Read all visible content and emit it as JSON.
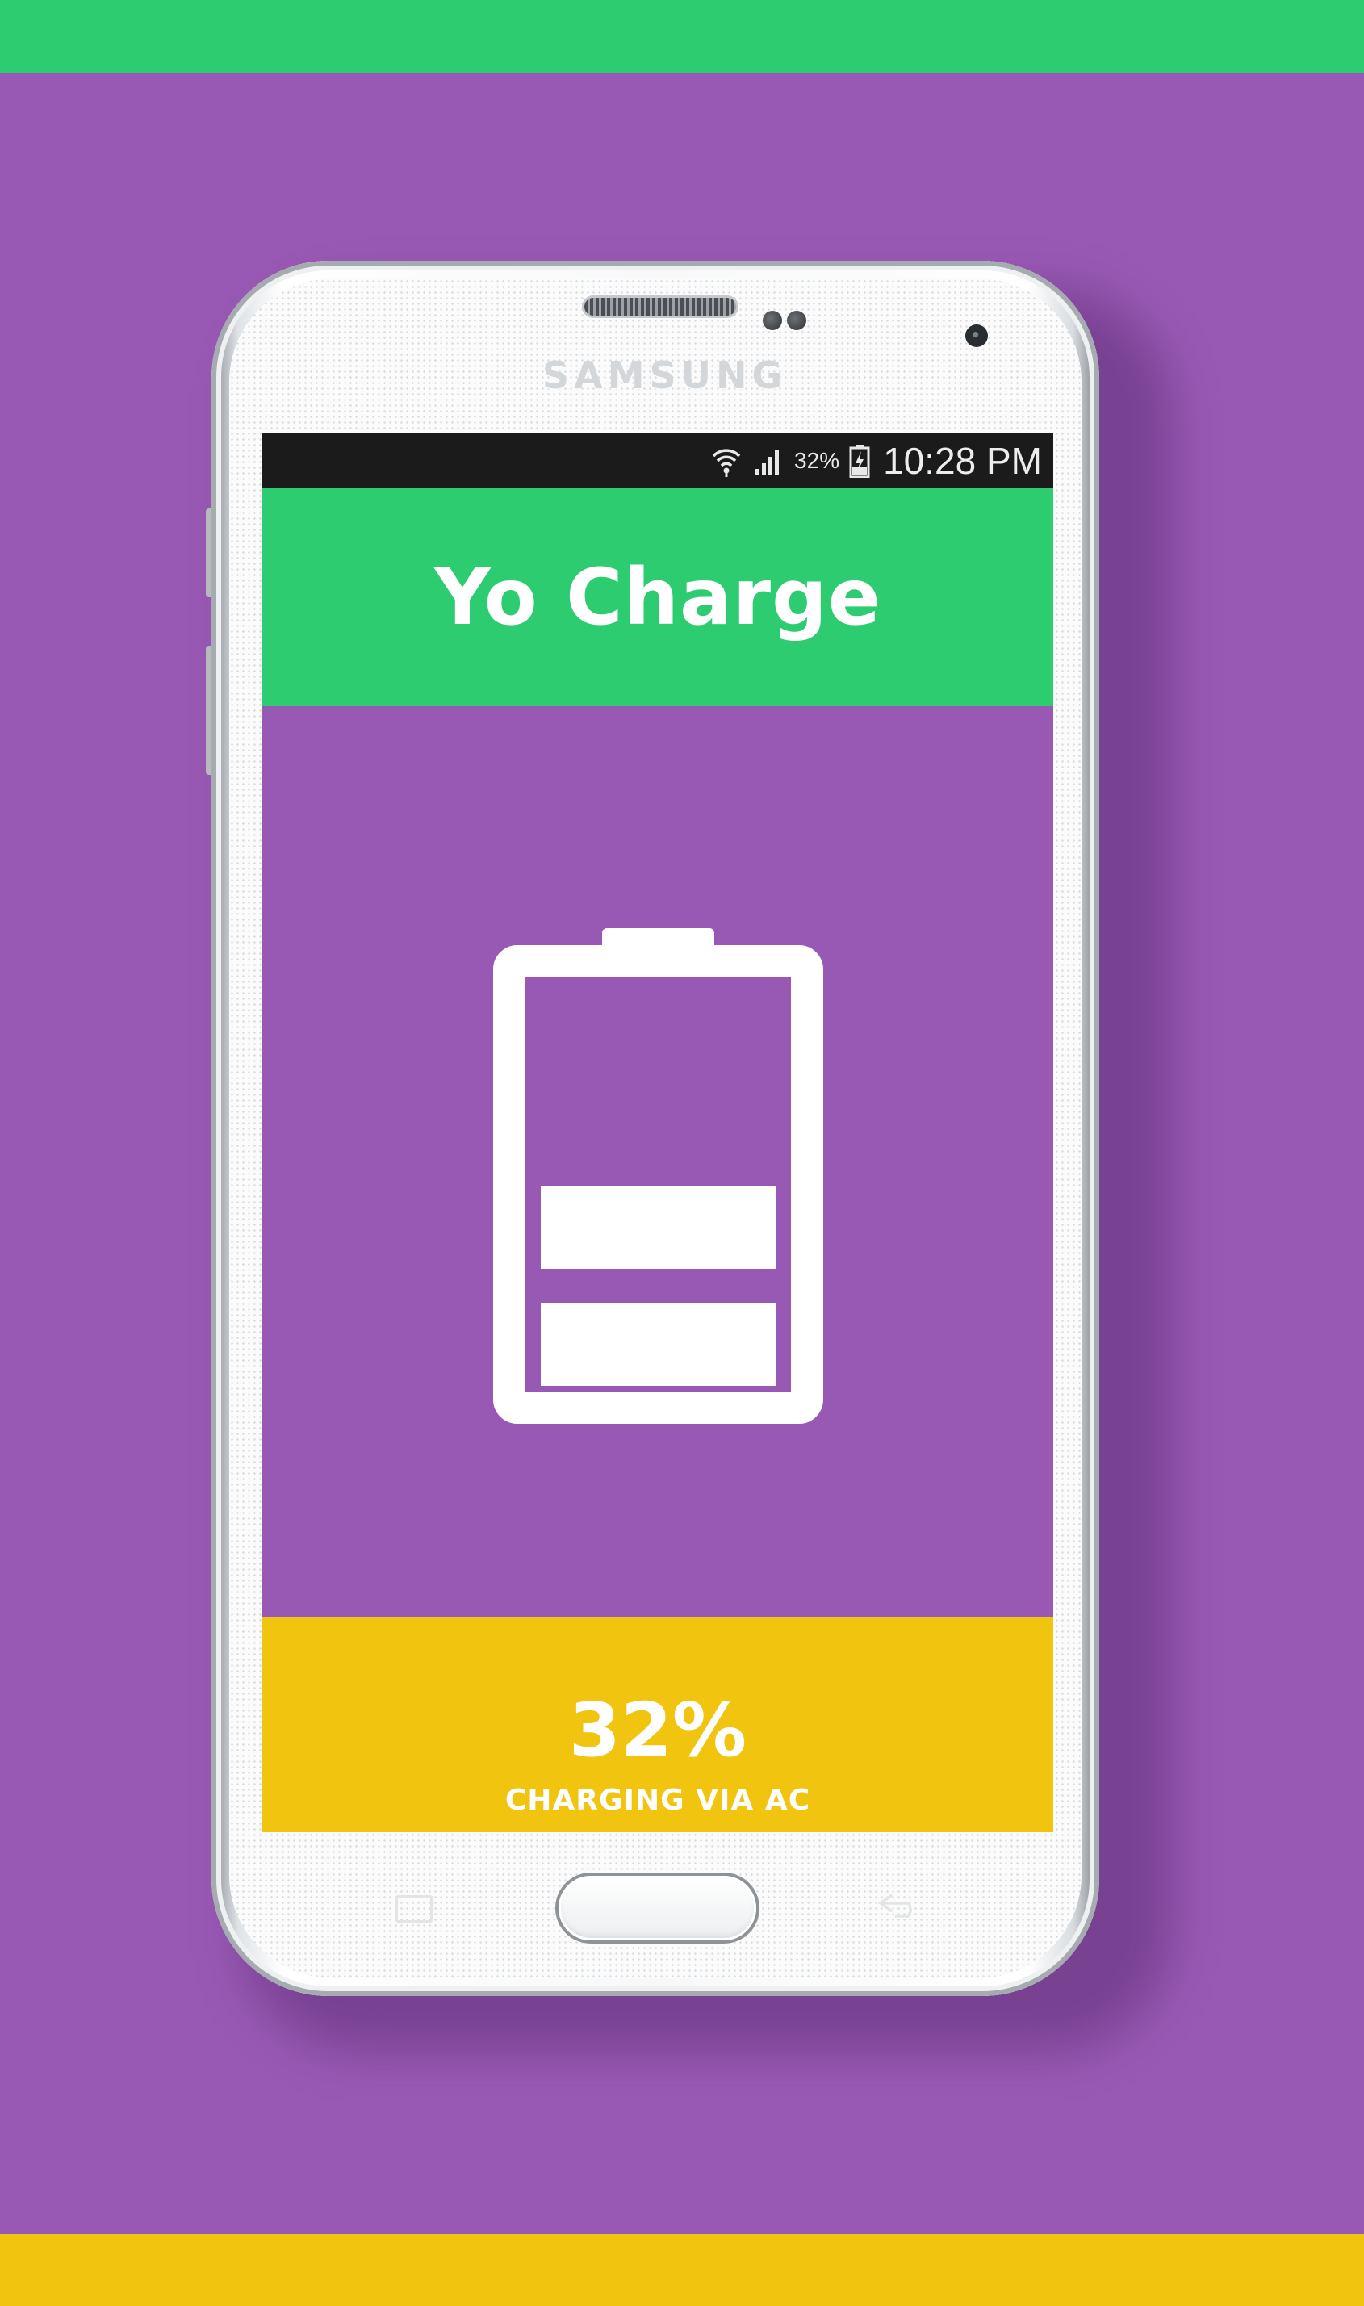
{
  "device": {
    "brand": "SAMSUNG"
  },
  "status_bar": {
    "battery_percent": "32%",
    "time": "10:28 PM",
    "icons": [
      "wifi-icon",
      "signal-icon",
      "battery-charging-icon"
    ]
  },
  "app": {
    "title": "Yo Charge"
  },
  "battery": {
    "level": 0.32,
    "bars_filled": 2,
    "icon": "battery-icon"
  },
  "status_panel": {
    "percent": "32%",
    "source": "CHARGING VIA AC"
  },
  "colors": {
    "green": "#2ecc71",
    "purple": "#9859b4",
    "yellow": "#f1c40f",
    "white": "#ffffff"
  }
}
